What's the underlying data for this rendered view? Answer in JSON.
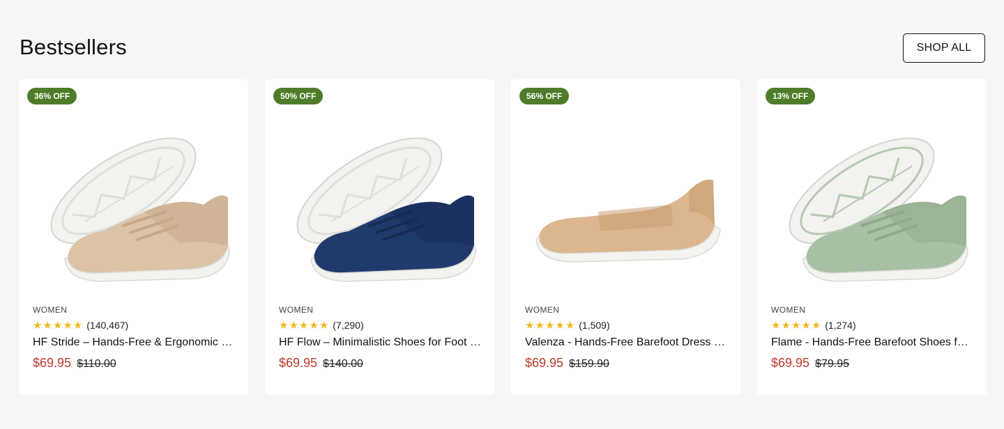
{
  "section": {
    "title": "Bestsellers",
    "shop_all_label": "SHOP ALL"
  },
  "colors": {
    "badge": "#4e7c2a",
    "sale_price": "#c0392b",
    "star": "#f2b821"
  },
  "products": [
    {
      "badge": "36% OFF",
      "category": "WOMEN",
      "reviews": "(140,467)",
      "name": "HF Stride – Hands-Free & Ergonomic Barefoot Shoes",
      "price": "$69.95",
      "compare_price": "$110.00",
      "rating": 5,
      "image": {
        "upper": "#dcc3a6",
        "upper_dark": "#c7a98a",
        "sole": "#f2f2ef",
        "sole_detail": "#dedede"
      }
    },
    {
      "badge": "50% OFF",
      "category": "WOMEN",
      "reviews": "(7,290)",
      "name": "HF Flow – Minimalistic Shoes for Foot Comfort",
      "price": "$69.95",
      "compare_price": "$140.00",
      "rating": 5,
      "image": {
        "upper": "#213a6e",
        "upper_dark": "#172b55",
        "sole": "#f2f2ef",
        "sole_detail": "#dedede"
      }
    },
    {
      "badge": "56% OFF",
      "category": "WOMEN",
      "reviews": "(1,509)",
      "name": "Valenza - Hands-Free Barefoot Dress Shoes",
      "price": "$69.95",
      "compare_price": "$159.90",
      "rating": 5,
      "image": {
        "upper": "#dbb68f",
        "upper_dark": "#c99d74",
        "sole": "#f4f3ef",
        "sole_detail": "#e2e0da"
      }
    },
    {
      "badge": "13% OFF",
      "category": "WOMEN",
      "reviews": "(1,274)",
      "name": "Flame - Hands-Free Barefoot Shoes for Women",
      "price": "$69.95",
      "compare_price": "$79.95",
      "rating": 5,
      "image": {
        "upper": "#a8c0a3",
        "upper_dark": "#8fa98a",
        "sole": "#f2f2ef",
        "sole_detail": "#b8c8b3"
      }
    }
  ]
}
